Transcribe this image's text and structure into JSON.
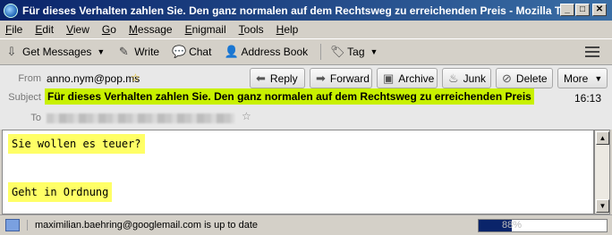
{
  "window": {
    "title": "Für dieses Verhalten zahlen Sie. Den ganz normalen auf dem Rechtsweg zu erreichenden Preis - Mozilla T...",
    "minimize": "_",
    "maximize": "□",
    "close": "✕"
  },
  "menu": [
    "File",
    "Edit",
    "View",
    "Go",
    "Message",
    "Enigmail",
    "Tools",
    "Help"
  ],
  "toolbar": {
    "get_messages": "Get Messages",
    "write": "Write",
    "chat": "Chat",
    "address_book": "Address Book",
    "tag": "Tag"
  },
  "header": {
    "from_label": "From",
    "from_value": "anno.nym@pop.ms",
    "subject_label": "Subject",
    "subject_value": "Für dieses Verhalten zahlen Sie. Den ganz normalen auf dem Rechtsweg zu erreichenden Preis",
    "to_label": "To",
    "time": "16:13",
    "buttons": {
      "reply": "Reply",
      "forward": "Forward",
      "archive": "Archive",
      "junk": "Junk",
      "delete": "Delete",
      "more": "More"
    }
  },
  "body": {
    "line1": "Sie wollen es teuer?",
    "line2": "Geht in Ordnung"
  },
  "status": {
    "text": "maximilian.baehring@googlemail.com is up to date",
    "progress_label": "88%",
    "progress": 0.26
  }
}
